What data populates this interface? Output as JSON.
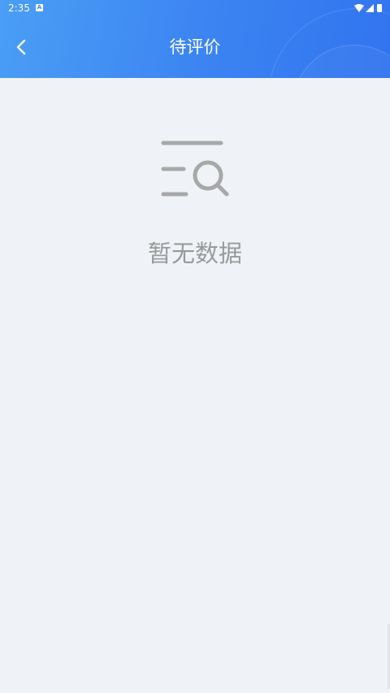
{
  "status_bar": {
    "time": "2:35",
    "notification_badge": "A",
    "icons": [
      "wifi-icon",
      "signal-icon",
      "battery-icon"
    ]
  },
  "header": {
    "title": "待评价",
    "back_icon": "chevron-left-icon",
    "gradient_colors": [
      "#4a9ef5",
      "#3274ef"
    ]
  },
  "empty_state": {
    "icon": "search-list-icon",
    "message": "暂无数据"
  },
  "colors": {
    "background": "#eff3f8",
    "empty_text": "#999999",
    "icon_gray": "#a8a8a8"
  }
}
